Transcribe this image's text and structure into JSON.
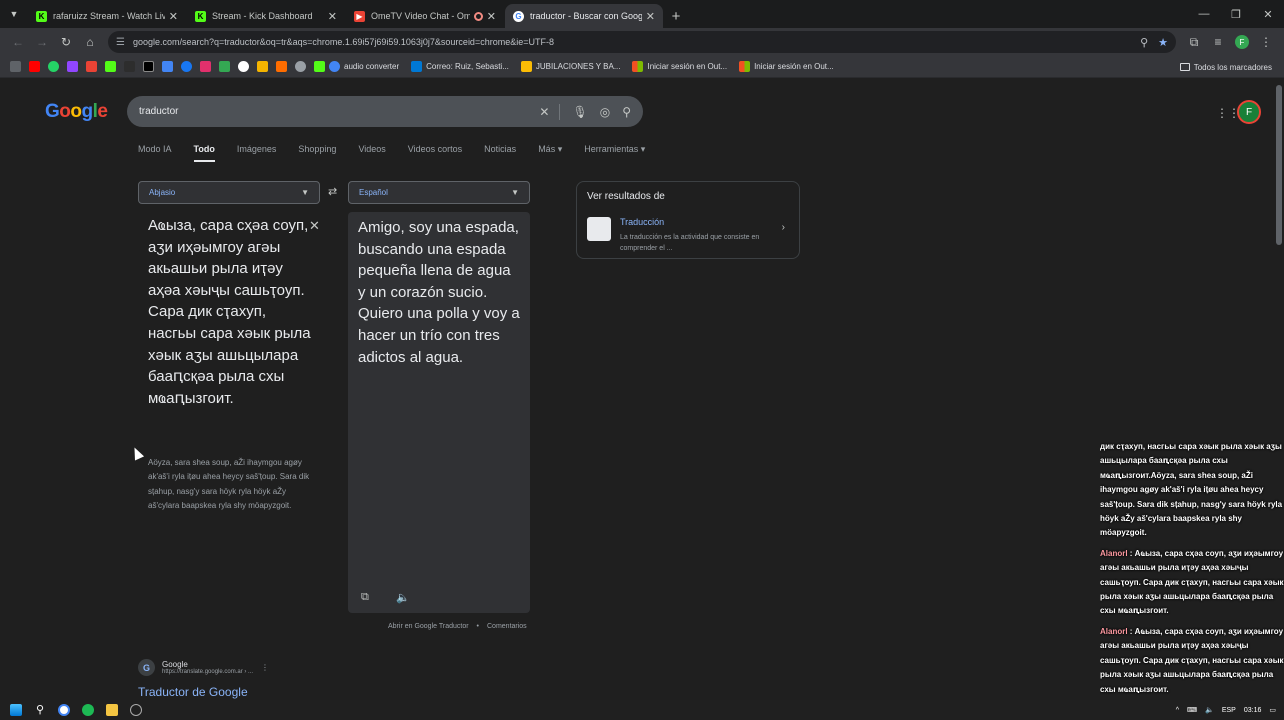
{
  "browser": {
    "tabs": [
      {
        "title": "rafaruizz Stream - Watch Live o",
        "favicon": "kick-icon",
        "color": "#53fc18",
        "active": false
      },
      {
        "title": "Stream - Kick Dashboard",
        "favicon": "kick-icon",
        "color": "#53fc18",
        "active": false
      },
      {
        "title": "OmeTV Video Chat - Ome",
        "favicon": "ometv-icon",
        "color": "#ea4335",
        "active": false,
        "recording": true
      },
      {
        "title": "traductor - Buscar con Google",
        "favicon": "google-icon",
        "color": "#ffffff",
        "active": true
      }
    ],
    "url": "google.com/search?q=traductor&oq=tr&aqs=chrome.1.69i57j69i59.1063j0j7&sourceid=chrome&ie=UTF-8",
    "profile_initial": "F"
  },
  "bookmarks": {
    "items": [
      {
        "label": "audio converter",
        "color": "#4285f4"
      },
      {
        "label": "Correo: Ruiz, Sebasti...",
        "color": "#0078d4"
      },
      {
        "label": "JUBILACIONES Y BA...",
        "color": "#fbbc05"
      },
      {
        "label": "Iniciar sesión en Out...",
        "color": "#f25022"
      },
      {
        "label": "Iniciar sesión en Out...",
        "color": "#f25022"
      }
    ],
    "all_bookmarks": "Todos los marcadores"
  },
  "search": {
    "logo": "Google",
    "query": "traductor",
    "nav_tabs": [
      "Modo IA",
      "Todo",
      "Imágenes",
      "Shopping",
      "Videos",
      "Videos cortos",
      "Noticias",
      "Más ▾",
      "Herramientas ▾"
    ],
    "active_tab": "Todo"
  },
  "translator": {
    "source_lang": "Abjasio",
    "target_lang": "Español",
    "source_text": "Аҩыза, сара сҳәа соуп, аӡи иҳәымгоу агәы акьашьи рыла иҭәу аҳәа хәыҷы сашьҭоуп. Сара дик сҭахуп, насгьы сара хәык рыла хәык аӡы ашьцылара бааԥсқәа рыла схы мҩаԥызгоит.",
    "transliteration": "Aöyza, sara shea soup, aŽi ihaymgou agøy ak'aš'i ryla ițøu ahea heycy saš'țoup. Sara dik sțahup, nasg'y sara höyk ryla höyk aŽy aš'cylara baapskea ryla shy möapyzgoit.",
    "target_text": "Amigo, soy una espada, buscando una espada pequeña llena de agua y un corazón sucio. Quiero una polla y voy a hacer un trío con tres adictos al agua.",
    "open_link": "Abrir en Google Traductor",
    "feedback": "Comentarios"
  },
  "knowledge_panel": {
    "header": "Ver resultados de",
    "title": "Traducción",
    "description": "La traducción es la actividad que consiste en comprender el ..."
  },
  "result": {
    "site_name": "Google",
    "cite": "https://translate.google.com.ar › ...",
    "title": "Traductor de Google"
  },
  "chat": [
    {
      "user": "",
      "text": "дик сҭахуп, насгьы сара хәык рыла хәык аӡы ашьцылара бааԥсқәа рыла схы мҩаԥызгоит.Aöyza, sara shea soup, aŽi ihaymgou agøy ak'aš'i ryla ițøu ahea heycy saš'țoup. Sara dik sțahup, nasg'y sara höyk ryla höyk aŽy aš'cylara baapskea ryla shy möapyzgoit."
    },
    {
      "user": "Alanorl",
      "text": "Аҩыза, сара сҳәа соуп, аӡи иҳәымгоу агәы акьашьи рыла иҭәу аҳәа хәыҷы сашьҭоуп. Сара дик сҭахуп, насгьы сара хәык рыла хәык аӡы ашьцылара бааԥсқәа рыла схы мҩаԥызгоит."
    },
    {
      "user": "Alanorl",
      "text": "Аҩыза, сара сҳәа соуп, аӡи иҳәымгоу агәы акьашьи рыла иҭәу аҳәа хәыҷы сашьҭоуп. Сара дик сҭахуп, насгьы сара хәык рыла хәык аӡы ашьцылара бааԥсқәа рыла схы мҩаԥызгоит."
    }
  ],
  "taskbar": {
    "lang": "ESP",
    "time": "03:16"
  }
}
